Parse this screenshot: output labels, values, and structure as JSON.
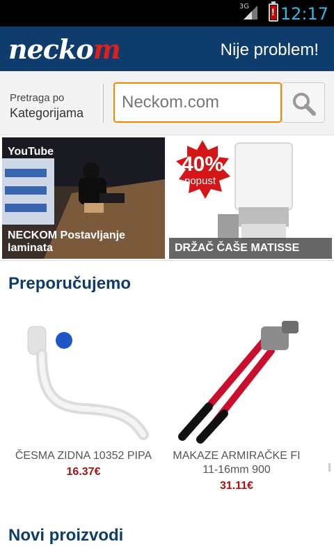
{
  "status_bar": {
    "network": "3G",
    "time": "12:17",
    "battery_icon": "battery-warning-icon"
  },
  "header": {
    "logo_main": "necko",
    "logo_accent": "m",
    "slogan": "Nije problem!"
  },
  "search": {
    "category_label_small": "Pretraga po",
    "category_label_big": "Kategorijama",
    "placeholder": "Neckom.com",
    "value": "",
    "search_icon": "search-icon"
  },
  "banners": [
    {
      "badge": "YouTube",
      "caption": "NECKOM Postavljanje laminata"
    },
    {
      "discount": "40%",
      "discount_label": "popust",
      "caption": "DRŽAČ ČAŠE  MATISSE"
    }
  ],
  "recommended": {
    "title": "Preporučujemo",
    "products": [
      {
        "name": "ČESMA ZIDNA 10352 PIPA",
        "price": "16.37€"
      },
      {
        "name": "MAKAZE ARMIRAČKE FI 11-16mm 900",
        "price": "31.11€"
      }
    ]
  },
  "new_products": {
    "title": "Novi proizvodi"
  },
  "colors": {
    "brand": "#0e3c6c",
    "accent": "#e0201b",
    "search_border": "#f08a00",
    "price": "#aa1111"
  }
}
